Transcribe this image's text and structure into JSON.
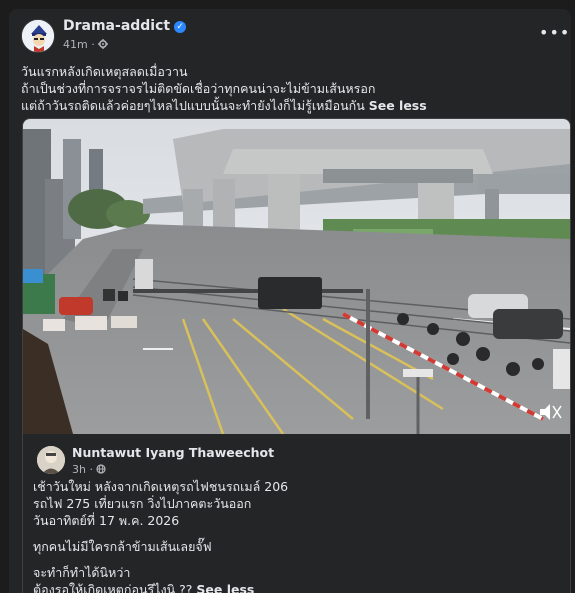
{
  "post": {
    "page_name": "Drama-addict",
    "time": "41m",
    "privacy_icon": "gear-icon",
    "more_icon": "more-options-icon",
    "caption_lines": [
      "วันแรกหลังเกิดเหตุสลดเมื่อวาน",
      "ถ้าเป็นช่วงที่การจราจรไม่ติดขัดเชื่อว่าทุกคนน่าจะไม่ข้ามเส้นหรอก",
      "แต่ถ้าวันรถติดแล้วค่อยๆไหลไปแบบนั้นจะทำยังไงก็ไม่รู้เหมือนกัน"
    ],
    "see_less": "See less"
  },
  "shared": {
    "author": "Nuntawut Iyang Thaweechot",
    "time": "3h",
    "privacy_icon": "globe-icon",
    "paragraphs": [
      [
        "เช้าวันใหม่ หลังจากเกิดเหตุรถไฟชนรถเมล์ 206",
        "รถไฟ 275 เที่ยวแรก วิ่งไปภาคตะวันออก",
        "วันอาทิตย์ที่ 17 พ.ค. 2026"
      ],
      [
        "ทุกคนไม่มีใครกล้าข้ามเส้นเลยจั๊ฟ"
      ],
      [
        "จะทำก็ทำได้นิหว่า",
        "ต้องรอให้เกิดเหตุก่อนรึไงนิ ??"
      ]
    ],
    "see_less": "See less"
  },
  "colors": {
    "accent": "#2d88ff",
    "card": "#242526",
    "text": "#e4e6eb",
    "muted": "#b0b3b8"
  }
}
